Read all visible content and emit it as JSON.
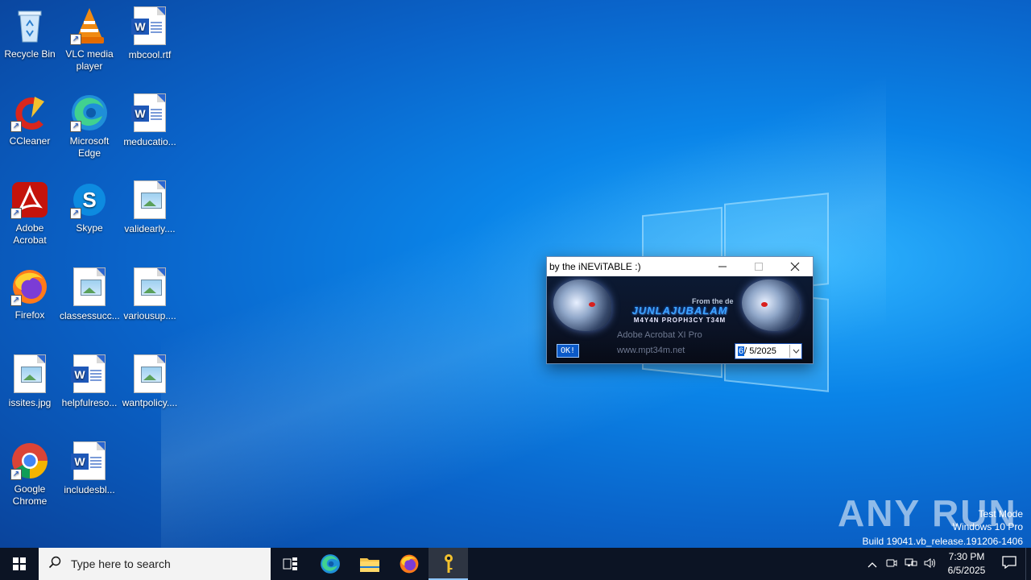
{
  "desktop": {
    "icons": [
      {
        "label": "Recycle Bin",
        "icon": "recycle-bin-icon"
      },
      {
        "label": "VLC media player",
        "icon": "vlc-icon"
      },
      {
        "label": "mbcool.rtf",
        "icon": "word-doc-icon"
      },
      {
        "label": "CCleaner",
        "icon": "ccleaner-icon"
      },
      {
        "label": "Microsoft Edge",
        "icon": "edge-icon"
      },
      {
        "label": "meducatio...",
        "icon": "word-doc-icon"
      },
      {
        "label": "Adobe Acrobat",
        "icon": "acrobat-icon"
      },
      {
        "label": "Skype",
        "icon": "skype-icon"
      },
      {
        "label": "validearly....",
        "icon": "image-file-icon"
      },
      {
        "label": "Firefox",
        "icon": "firefox-icon"
      },
      {
        "label": "classessucc...",
        "icon": "image-file-icon"
      },
      {
        "label": "variousup....",
        "icon": "image-file-icon"
      },
      {
        "label": "issites.jpg",
        "icon": "image-file-icon"
      },
      {
        "label": "helpfulreso...",
        "icon": "word-doc-icon"
      },
      {
        "label": "wantpolicy....",
        "icon": "image-file-icon"
      },
      {
        "label": "Google Chrome",
        "icon": "chrome-icon"
      },
      {
        "label": "includesbl...",
        "icon": "word-doc-icon"
      }
    ]
  },
  "dialog": {
    "title": "by the iNEViTABLE :)",
    "from_text": "From the de",
    "brand": "JUNLAJUBALAM",
    "team": "M4Y4N PROPH3CY T34M",
    "product": "Adobe Acrobat XI Pro",
    "url": "www.mpt34m.net",
    "ok_label": "OK!",
    "date_cursor": "6",
    "date_rest": "/  5/2025"
  },
  "watermark": {
    "brand": "ANY RUN",
    "mode": "Test Mode",
    "os": "Windows 10 Pro",
    "build": "Build 19041.vb_release.191206-1406"
  },
  "taskbar": {
    "search_placeholder": "Type here to search",
    "time": "7:30 PM",
    "date": "6/5/2025"
  },
  "colors": {
    "accent": "#0a84e8",
    "taskbar": "#0c1424",
    "dialog_banner": "#0c1a33"
  }
}
